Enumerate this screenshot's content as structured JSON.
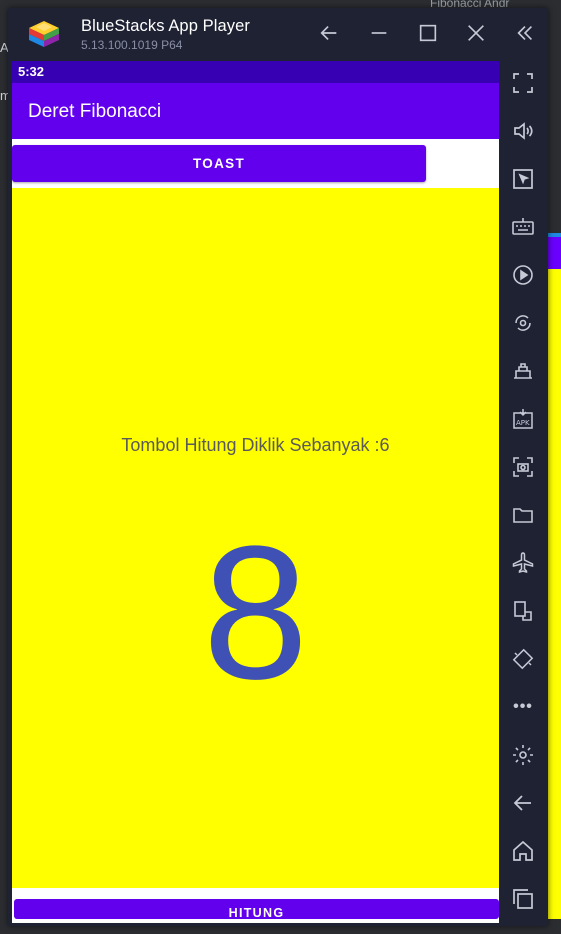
{
  "desktop": {
    "tab_fragment": "Fibonacci Andr",
    "left_fragment_1": "AD",
    "left_fragment_2": "m"
  },
  "window": {
    "title": "BlueStacks App Player",
    "version": "5.13.100.1019  P64",
    "controls": [
      "back-icon",
      "minimize-icon",
      "maximize-icon",
      "close-icon",
      "collapse-sidebar-icon"
    ]
  },
  "android": {
    "status_time": "5:32",
    "app_title": "Deret Fibonacci",
    "toast_button": "TOAST",
    "click_count_text": "Tombol Hitung Diklik Sebanyak :6",
    "fibonacci_value": "8",
    "hitung_button": "HITUNG"
  },
  "sidebar_tools": [
    "fullscreen-icon",
    "volume-icon",
    "pointer-icon",
    "keyboard-icon",
    "macro-record-icon",
    "sync-rotate-icon",
    "multi-instance-icon",
    "install-apk-icon",
    "screenshot-icon",
    "folder-icon",
    "airplane-icon",
    "shake-icon",
    "rotate-icon",
    "more-icon",
    "settings-icon",
    "android-back-icon",
    "android-home-icon",
    "recent-apps-icon"
  ],
  "colors": {
    "window_bg": "#1f2233",
    "status_bar": "#3700b3",
    "primary": "#6200ee",
    "content_bg": "#ffff00",
    "number_color": "#3f51b5"
  }
}
